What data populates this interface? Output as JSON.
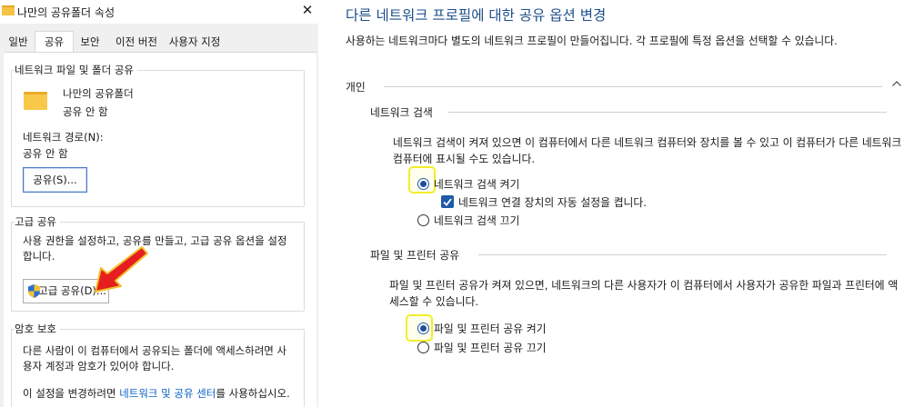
{
  "dialog": {
    "title": "나만의 공유폴더 속성",
    "close_glyph": "✕",
    "tabs": [
      "일반",
      "공유",
      "보안",
      "이전 버전",
      "사용자 지정"
    ],
    "active_tab": "공유",
    "network_share": {
      "group_label": "네트워크 파일 및 폴더 공유",
      "folder_name": "나만의 공유폴더",
      "folder_status": "공유 안 함",
      "path_label": "네트워크 경로(N):",
      "path_value": "공유 안 함",
      "share_button": "공유(S)..."
    },
    "advanced_share": {
      "group_label": "고급 공유",
      "description": "사용 권한을 설정하고, 공유를 만들고, 고급 공유 옵션을 설정합니다.",
      "button": "고급 공유(D)..."
    },
    "password": {
      "group_label": "암호 보호",
      "description": "다른 사람이 이 컴퓨터에서 공유되는 폴더에 액세스하려면 사용자 계정과 암호가 있어야 합니다.",
      "change_prefix": "이 설정을 변경하려면",
      "link_text": "네트워크 및 공유 센터",
      "change_suffix": "를 사용하십시오."
    }
  },
  "settings": {
    "title": "다른 네트워크 프로필에 대한 공유 옵션 변경",
    "description": "사용하는 네트워크마다 별도의 네트워크 프로필이 만들어집니다. 각 프로필에 특정 옵션을 선택할 수 있습니다.",
    "profile_label": "개인",
    "network_discovery": {
      "label": "네트워크 검색",
      "description": "네트워크 검색이 켜져 있으면 이 컴퓨터에서 다른 네트워크 컴퓨터와 장치를 볼 수 있고 이 컴퓨터가 다른 네트워크 컴퓨터에 표시될 수도 있습니다.",
      "option_on": "네트워크 검색 켜기",
      "option_on_selected": true,
      "auto_setup": "네트워크 연결 장치의 자동 설정을 켭니다.",
      "auto_setup_checked": true,
      "option_off": "네트워크 검색 끄기"
    },
    "file_printer": {
      "label": "파일 및 프린터 공유",
      "description": "파일 및 프린터 공유가 켜져 있으면, 네트워크의 다른 사용자가 이 컴퓨터에서 사용자가 공유한 파일과 프린터에 액세스할 수 있습니다.",
      "option_on": "파일 및 프린터 공유 켜기",
      "option_on_selected": true,
      "option_off": "파일 및 프린터 공유 끄기"
    }
  },
  "colors": {
    "title_blue": "#1e4e8c",
    "link_blue": "#0a61c4",
    "highlight_yellow": "#f2ee2a",
    "arrow_red": "#e51f1f"
  }
}
